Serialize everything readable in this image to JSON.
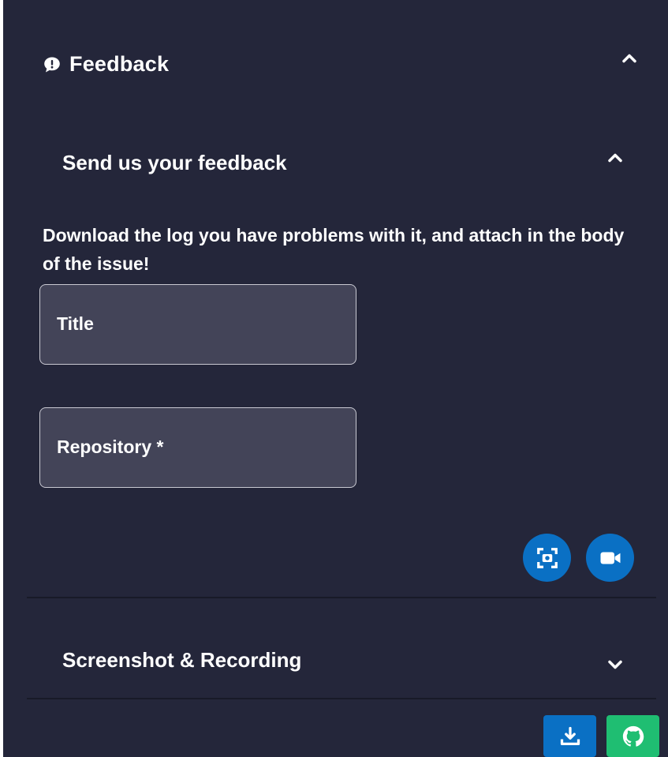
{
  "panel": {
    "title": "Feedback",
    "title_icon": "feedback-bubble-icon",
    "collapse_icon": "chevron-up-icon"
  },
  "send_section": {
    "title": "Send us your feedback",
    "toggle_icon": "chevron-up-icon",
    "description": "Download the log you have problems with it, and attach in the body of the issue!",
    "fields": {
      "title_label": "Title",
      "repository_label": "Repository *"
    },
    "actions": {
      "screenshot_icon": "screenshot-capture-icon",
      "record_icon": "video-camera-icon"
    }
  },
  "screenshot_section": {
    "title": "Screenshot & Recording",
    "toggle_icon": "chevron-down-icon"
  },
  "footer": {
    "download_icon": "download-icon",
    "github_icon": "github-icon"
  },
  "colors": {
    "panel_bg": "#24263a",
    "field_bg": "#434458",
    "primary_blue": "#0a70c4",
    "github_green": "#1fbe72",
    "divider": "#181a28",
    "text": "#ffffff"
  }
}
